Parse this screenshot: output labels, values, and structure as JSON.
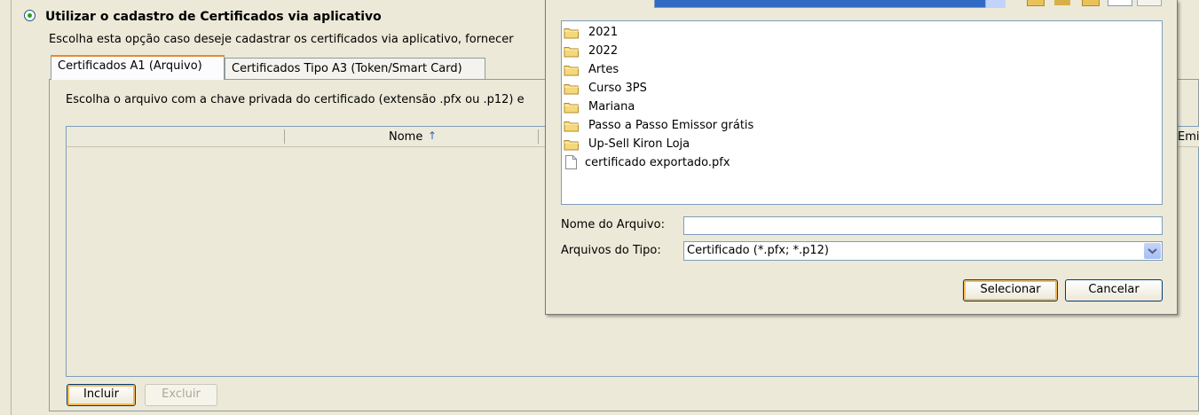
{
  "option": {
    "title": "Utilizar o cadastro de Certificados via aplicativo",
    "description": "Escolha esta opção caso deseje cadastrar os certificados via aplicativo, fornecer"
  },
  "tabs": [
    {
      "label": "Certificados A1 (Arquivo)"
    },
    {
      "label": "Certificados Tipo A3 (Token/Smart Card)"
    }
  ],
  "instruction": "Escolha o arquivo com a chave privada do certificado (extensão .pfx ou .p12) e",
  "table": {
    "columns": [
      "Nome",
      "Emi"
    ],
    "sort_indicator": "↑"
  },
  "buttons": {
    "include": "Incluir",
    "exclude": "Excluir"
  },
  "dialog": {
    "files": [
      {
        "name": "2021",
        "type": "folder"
      },
      {
        "name": "2022",
        "type": "folder"
      },
      {
        "name": "Artes",
        "type": "folder"
      },
      {
        "name": "Curso 3PS",
        "type": "folder"
      },
      {
        "name": "Mariana",
        "type": "folder"
      },
      {
        "name": "Passo a Passo Emissor grátis",
        "type": "folder"
      },
      {
        "name": "Up-Sell Kiron Loja",
        "type": "folder"
      },
      {
        "name": "certificado exportado.pfx",
        "type": "file"
      }
    ],
    "filename_label": "Nome do Arquivo:",
    "filename_value": "",
    "filetype_label": "Arquivos do Tipo:",
    "filetype_value": "Certificado (*.pfx; *.p12)",
    "select_button": "Selecionar",
    "cancel_button": "Cancelar"
  },
  "colors": {
    "window_bg": "#ece9d8",
    "radio_dot": "#21a121",
    "tab_highlight": "#e68b2c",
    "selection_blue": "#316ac5"
  }
}
